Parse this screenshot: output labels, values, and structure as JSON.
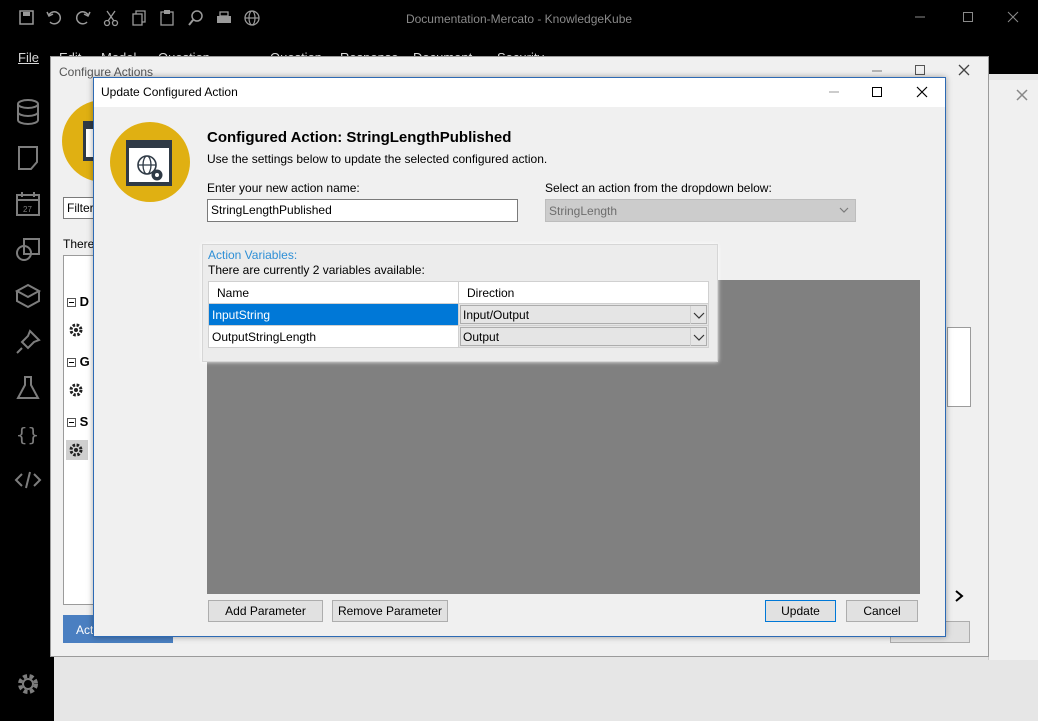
{
  "app": {
    "title": "Documentation-Mercato - KnowledgeKube",
    "menu": [
      "File",
      "Edit",
      "Model",
      "Question Groups",
      "Question",
      "Response",
      "Document",
      "Security"
    ]
  },
  "configure_dialog": {
    "title": "Configure Actions",
    "filter_label": "Filter",
    "info_label": "There",
    "tree_groups": [
      "D",
      "G",
      "S"
    ],
    "bottom_button": "Act"
  },
  "update_dialog": {
    "title": "Update Configured Action",
    "heading": "Configured Action: StringLengthPublished",
    "subheading": "Use the settings below to update the selected configured action.",
    "name_label": "Enter your new action name:",
    "name_value": "StringLengthPublished",
    "action_label": "Select an action from the dropdown below:",
    "action_value": "StringLength",
    "vars_title": "Action Variables:",
    "vars_count": "There are currently 2 variables available:",
    "columns": [
      "Name",
      "Direction"
    ],
    "rows": [
      {
        "name": "InputString",
        "direction": "Input/Output"
      },
      {
        "name": "OutputStringLength",
        "direction": "Output"
      }
    ],
    "buttons": {
      "add": "Add Parameter",
      "remove": "Remove Parameter",
      "update": "Update",
      "cancel": "Cancel"
    }
  },
  "colors": {
    "accent": "#0078d7",
    "icon_gold": "#e0b012",
    "link_blue": "#2e8fd6"
  }
}
